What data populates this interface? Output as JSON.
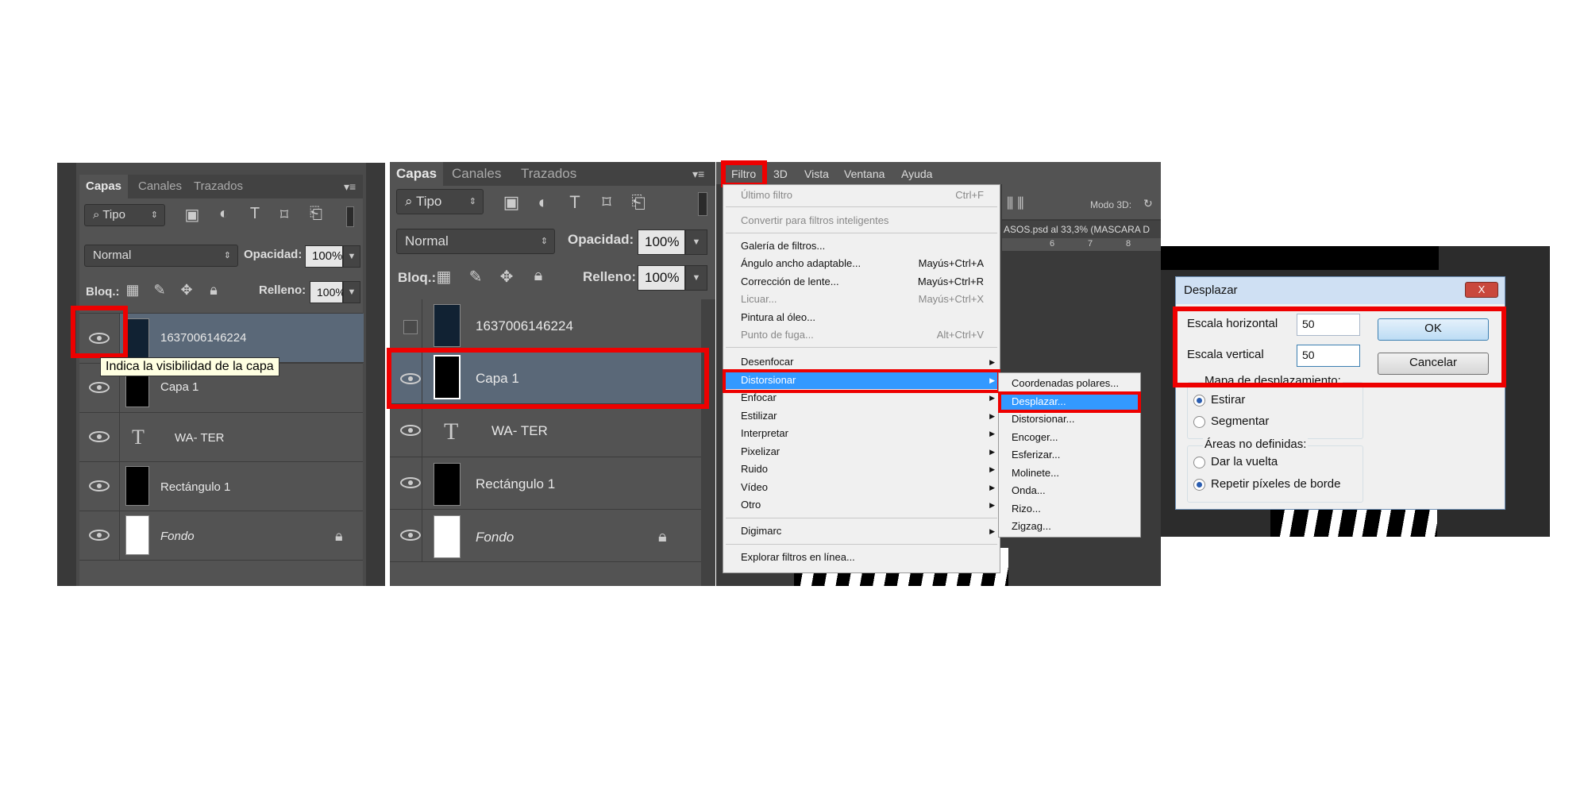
{
  "panel1": {
    "tabs": [
      "Capas",
      "Canales",
      "Trazados"
    ],
    "filter_label": "Tipo",
    "blend_mode": "Normal",
    "opacity_label": "Opacidad:",
    "opacity_value": "100%",
    "lock_label": "Bloq.:",
    "fill_label": "Relleno:",
    "fill_value": "100%",
    "layers": [
      {
        "name": "1637006146224"
      },
      {
        "name": "Capa 1"
      },
      {
        "name": "WA- TER"
      },
      {
        "name": "Rectángulo 1"
      },
      {
        "name": "Fondo"
      }
    ],
    "tooltip": "Indica la visibilidad de la capa"
  },
  "panel2": {
    "tabs": [
      "Capas",
      "Canales",
      "Trazados"
    ],
    "filter_label": "Tipo",
    "blend_mode": "Normal",
    "opacity_label": "Opacidad:",
    "opacity_value": "100%",
    "lock_label": "Bloq.:",
    "fill_label": "Relleno:",
    "fill_value": "100%",
    "layers": [
      {
        "name": "1637006146224"
      },
      {
        "name": "Capa 1"
      },
      {
        "name": "WA- TER"
      },
      {
        "name": "Rectángulo 1"
      },
      {
        "name": "Fondo"
      }
    ]
  },
  "menubar": {
    "items": [
      "Filtro",
      "3D",
      "Vista",
      "Ventana",
      "Ayuda"
    ],
    "mode3d": "Modo 3D:",
    "doc_tab": "ASOS.psd al 33,3% (MASCARA D",
    "ruler": [
      "6",
      "7",
      "8"
    ]
  },
  "filter_menu": {
    "items": [
      {
        "label": "Último filtro",
        "shortcut": "Ctrl+F",
        "disabled": true
      },
      {
        "label": "Convertir para filtros inteligentes",
        "disabled": true
      },
      {
        "label": "Galería de filtros..."
      },
      {
        "label": "Ángulo ancho adaptable...",
        "shortcut": "Mayús+Ctrl+A"
      },
      {
        "label": "Corrección de lente...",
        "shortcut": "Mayús+Ctrl+R"
      },
      {
        "label": "Licuar...",
        "shortcut": "Mayús+Ctrl+X",
        "disabled": true
      },
      {
        "label": "Pintura al óleo..."
      },
      {
        "label": "Punto de fuga...",
        "shortcut": "Alt+Ctrl+V",
        "disabled": true
      },
      {
        "label": "Desenfocar"
      },
      {
        "label": "Distorsionar"
      },
      {
        "label": "Enfocar"
      },
      {
        "label": "Estilizar"
      },
      {
        "label": "Interpretar"
      },
      {
        "label": "Pixelizar"
      },
      {
        "label": "Ruido"
      },
      {
        "label": "Vídeo"
      },
      {
        "label": "Otro"
      },
      {
        "label": "Digimarc"
      },
      {
        "label": "Explorar filtros en línea..."
      }
    ]
  },
  "distort_submenu": {
    "items": [
      "Coordenadas polares...",
      "Desplazar...",
      "Distorsionar...",
      "Encoger...",
      "Esferizar...",
      "Molinete...",
      "Onda...",
      "Rizo...",
      "Zigzag..."
    ]
  },
  "dialog": {
    "title": "Desplazar",
    "close": "X",
    "h_label": "Escala horizontal",
    "h_value": "50",
    "v_label": "Escala vertical",
    "v_value": "50",
    "ok": "OK",
    "cancel": "Cancelar",
    "map_group": "Mapa de desplazamiento:",
    "stretch": "Estirar",
    "tile": "Segmentar",
    "undef_group": "Áreas no definidas:",
    "wrap": "Dar la vuelta",
    "repeat": "Repetir píxeles de borde"
  }
}
